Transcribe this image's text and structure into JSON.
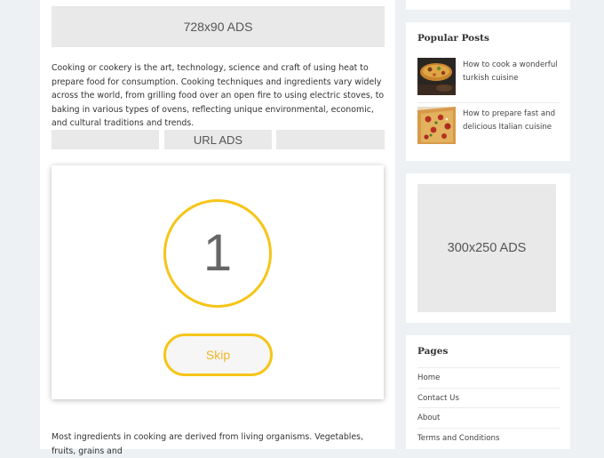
{
  "ads": {
    "top_banner": "728x90 ADS",
    "url_row": [
      "",
      "URL ADS",
      ""
    ],
    "sidebar_square": "300x250 ADS"
  },
  "article": {
    "para1": "Cooking or cookery is the art, technology, science and craft of using heat to prepare food for consumption. Cooking techniques and ingredients vary widely across the world, from grilling food over an open fire to using electric stoves, to baking in various types of ovens, reflecting unique environmental, economic, and cultural traditions and trends.",
    "para2": "Most ingredients in cooking are derived from living organisms. Vegetables, fruits, grains and"
  },
  "countdown": {
    "value": "1",
    "skip_label": "Skip"
  },
  "sidebar": {
    "popular_title": "Popular Posts",
    "posts": [
      {
        "title": "How to cook a wonderful turkish cuisine"
      },
      {
        "title": "How to prepare fast and delicious Italian cuisine"
      }
    ],
    "pages_title": "Pages",
    "pages": [
      "Home",
      "Contact Us",
      "About",
      "Terms and Conditions"
    ]
  },
  "colors": {
    "accent": "#f5c518",
    "skip_text": "#f0b429",
    "ad_bg": "#e9e9e9",
    "page_bg": "#edf1f4"
  }
}
